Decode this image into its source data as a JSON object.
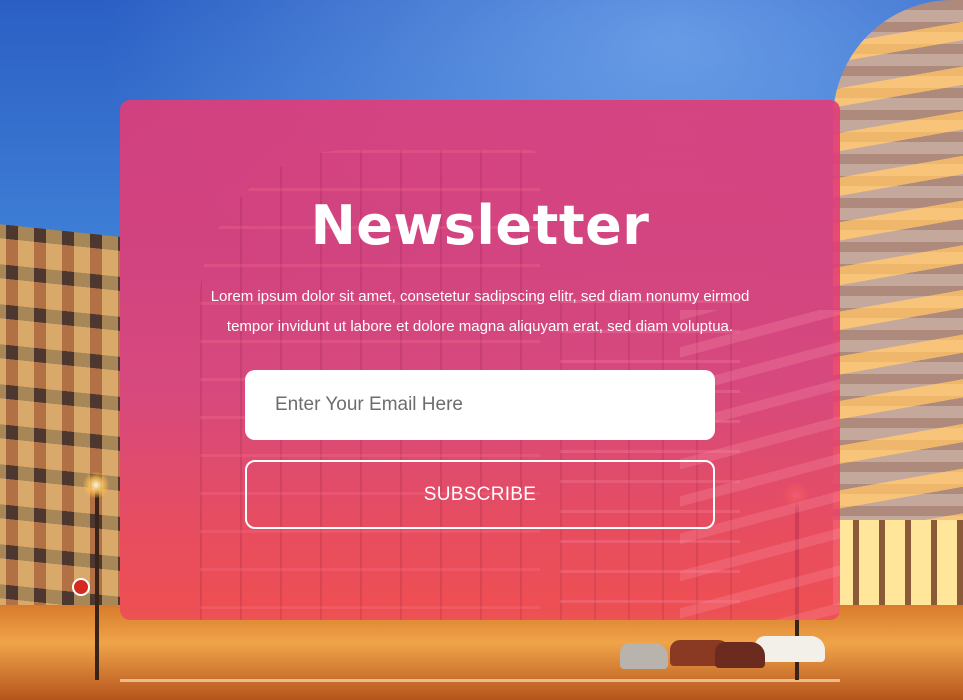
{
  "newsletter": {
    "title": "Newsletter",
    "description_line1": "Lorem ipsum dolor sit amet, consetetur sadipscing elitr, sed diam nonumy eirmod",
    "description_line2": "tempor invidunt ut labore et dolore magna aliquyam erat, sed diam voluptua.",
    "email_placeholder": "Enter Your Email Here",
    "email_value": "",
    "subscribe_label": "SUBSCRIBE"
  },
  "colors": {
    "card_overlay": "#e23c78",
    "button_border": "#ffffff",
    "text": "#ffffff"
  },
  "background": {
    "icon": "city-street-photo"
  }
}
